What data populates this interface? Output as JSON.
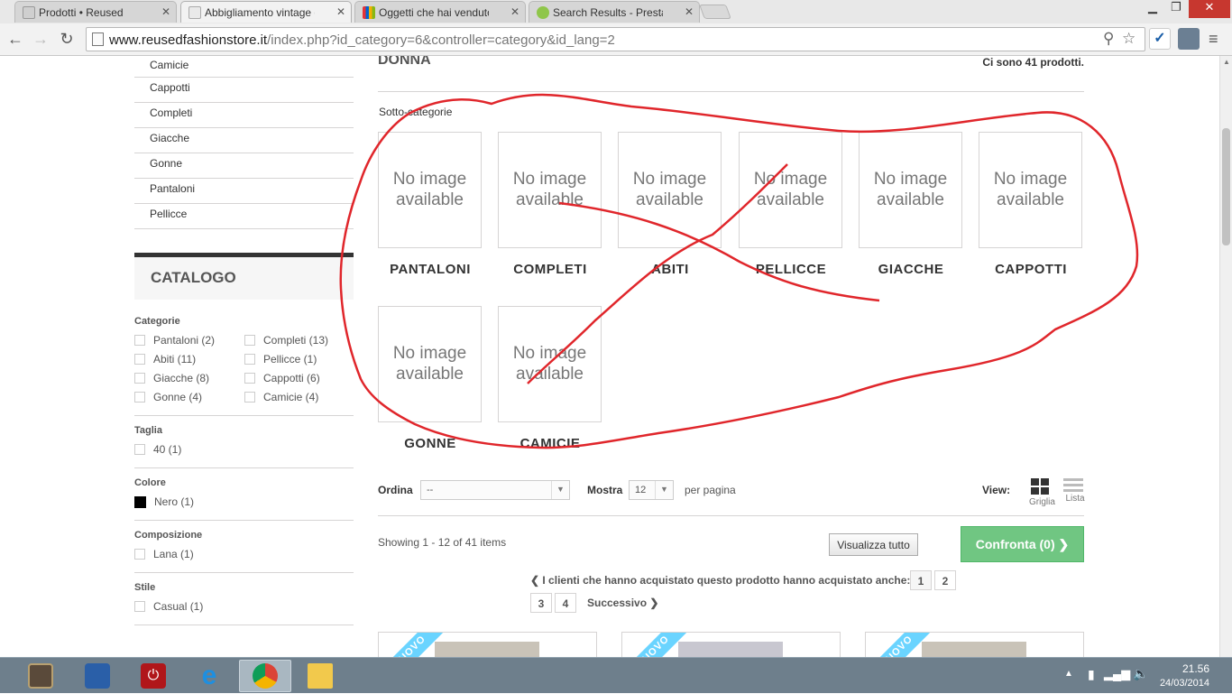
{
  "browser": {
    "tabs": [
      {
        "title": "Prodotti • Reused",
        "active": false
      },
      {
        "title": "Abbigliamento vintage do",
        "active": true
      },
      {
        "title": "Oggetti che hai venduto d",
        "active": false
      },
      {
        "title": "Search Results - PrestaSho",
        "active": false
      }
    ],
    "url_domain": "www.reusedfashionstore.it",
    "url_path": "/index.php?id_category=6&controller=category&id_lang=2"
  },
  "sidebar": {
    "categories": [
      "Camicie",
      "Cappotti",
      "Completi",
      "Giacche",
      "Gonne",
      "Pantaloni",
      "Pellicce"
    ],
    "catalog_title": "CATALOGO",
    "filters": {
      "categorie_title": "Categorie",
      "categorie": [
        "Pantaloni (2)",
        "Completi (13)",
        "Abiti (11)",
        "Pellicce (1)",
        "Giacche (8)",
        "Cappotti (6)",
        "Gonne (4)",
        "Camicie (4)"
      ],
      "taglia_title": "Taglia",
      "taglia": [
        "40 (1)"
      ],
      "colore_title": "Colore",
      "colore": [
        "Nero (1)"
      ],
      "colore_swatch": "#000000",
      "composizione_title": "Composizione",
      "composizione": [
        "Lana (1)"
      ],
      "stile_title": "Stile",
      "stile": [
        "Casual (1)"
      ]
    }
  },
  "main": {
    "heading": "DONNA",
    "product_count": "Ci sono 41 prodotti.",
    "subcat_title": "Sotto-categorie",
    "no_image": "No image available",
    "subcategories": [
      "PANTALONI",
      "COMPLETI",
      "ABITI",
      "PELLICCE",
      "GIACCHE",
      "CAPPOTTI",
      "GONNE",
      "CAMICIE"
    ],
    "sort_label": "Ordina",
    "sort_value": "--",
    "show_label": "Mostra",
    "show_value": "12",
    "per_page": "per pagina",
    "view_label": "View:",
    "view_grid": "Griglia",
    "view_list": "Lista",
    "showing": "Showing 1 - 12 of 41 items",
    "view_all": "Visualizza tutto",
    "compare": "Confronta (0)",
    "pagination_text": "I clienti che hanno acquistato questo prodotto hanno acquistato anche:",
    "pages": [
      "1",
      "2",
      "3",
      "4"
    ],
    "next": "Successivo",
    "ribbon": "NUOVO",
    "accent_color": "#70c682"
  },
  "taskbar": {
    "time": "21.56",
    "date": "24/03/2014"
  }
}
